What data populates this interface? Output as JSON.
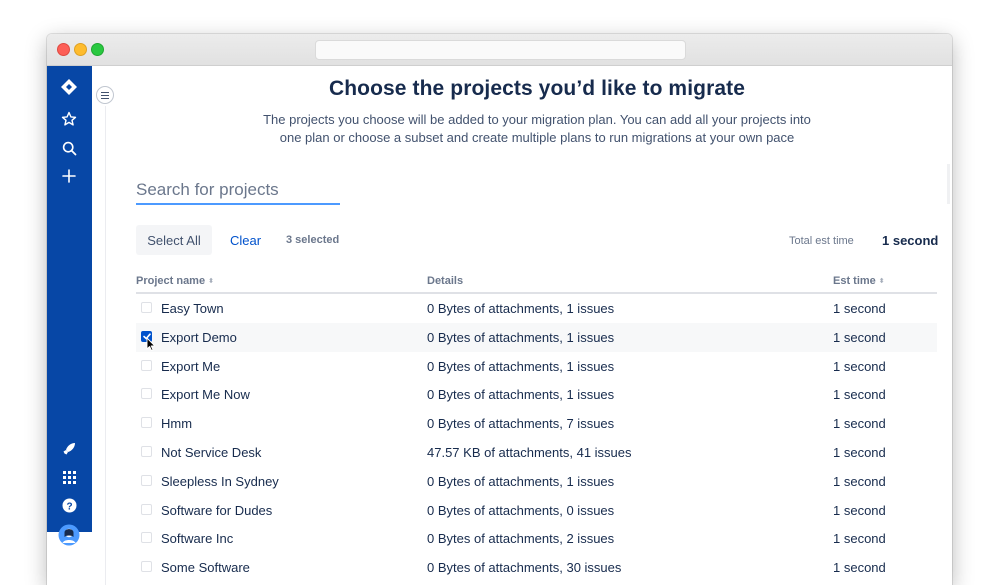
{
  "page": {
    "heading": "Choose the projects you’d like to migrate",
    "subtext_line1": "The projects you choose will be added to your migration plan. You can add all your projects into",
    "subtext_line2": "one plan or choose a subset and create multiple plans to run migrations at your own pace"
  },
  "search": {
    "placeholder": "Search for projects"
  },
  "toolbar": {
    "select_all_label": "Select All",
    "clear_label": "Clear",
    "selected_count": "3 selected",
    "total_label": "Total est time",
    "total_value": "1 second"
  },
  "table": {
    "headers": {
      "name": "Project name",
      "details": "Details",
      "est": "Est time"
    },
    "rows": [
      {
        "name": "Easy Town",
        "details": "0 Bytes of attachments, 1 issues",
        "est": "1 second",
        "checked": false
      },
      {
        "name": "Export Demo",
        "details": "0 Bytes of attachments, 1 issues",
        "est": "1 second",
        "checked": true
      },
      {
        "name": "Export Me",
        "details": "0 Bytes of attachments, 1 issues",
        "est": "1 second",
        "checked": false
      },
      {
        "name": "Export Me Now",
        "details": "0 Bytes of attachments, 1 issues",
        "est": "1 second",
        "checked": false
      },
      {
        "name": "Hmm",
        "details": "0 Bytes of attachments, 7 issues",
        "est": "1 second",
        "checked": false
      },
      {
        "name": "Not Service Desk",
        "details": "47.57 KB of attachments, 41 issues",
        "est": "1 second",
        "checked": false
      },
      {
        "name": "Sleepless In Sydney",
        "details": "0 Bytes of attachments, 1 issues",
        "est": "1 second",
        "checked": false
      },
      {
        "name": "Software for Dudes",
        "details": "0 Bytes of attachments, 0 issues",
        "est": "1 second",
        "checked": false
      },
      {
        "name": "Software Inc",
        "details": "0 Bytes of attachments, 2 issues",
        "est": "1 second",
        "checked": false
      },
      {
        "name": "Some Software",
        "details": "0 Bytes of attachments, 30 issues",
        "est": "1 second",
        "checked": false
      }
    ]
  },
  "sidebar": {
    "icons": [
      "jira-logo-icon",
      "star-icon",
      "search-icon",
      "plus-icon",
      "rocket-icon",
      "app-switcher-icon",
      "help-icon",
      "avatar"
    ]
  },
  "colors": {
    "sidebar": "#0747a6",
    "accent": "#0052cc",
    "focus": "#4c9aff"
  }
}
